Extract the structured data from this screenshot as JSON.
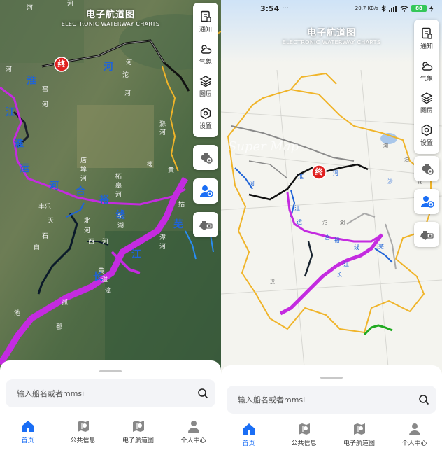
{
  "app": {
    "title_cn": "电子航道图",
    "title_en": "ELECTRONIC WATERWAY CHARTS"
  },
  "tools": [
    {
      "label": "通知",
      "icon": "notice-icon"
    },
    {
      "label": "气象",
      "icon": "weather-icon"
    },
    {
      "label": "图层",
      "icon": "layers-icon"
    },
    {
      "label": "设置",
      "icon": "settings-icon"
    }
  ],
  "search": {
    "placeholder": "输入船名或者mmsi"
  },
  "tabs": [
    {
      "label": "首页",
      "icon": "home-icon",
      "active": true
    },
    {
      "label": "公共信息",
      "icon": "public-info-icon",
      "active": false
    },
    {
      "label": "电子航道图",
      "icon": "chart-map-icon",
      "active": false
    },
    {
      "label": "个人中心",
      "icon": "person-icon",
      "active": false
    }
  ],
  "status": {
    "time": "3:54",
    "more": "···",
    "net_speed": "20.7 KB/s",
    "battery": "88"
  },
  "map": {
    "end_marker": "终",
    "watermark": "Super Map",
    "left_labels": [
      "河",
      "河",
      "沱",
      "河",
      "河",
      "淮",
      "河",
      "江",
      "淮",
      "运",
      "河",
      "合",
      "裕",
      "线",
      "长",
      "江",
      "芜",
      "丰乐",
      "天",
      "石",
      "白",
      "北",
      "河",
      "西",
      "河",
      "店埠河",
      "柘皋河",
      "杭",
      "湖",
      "江",
      "巢湖",
      "河",
      "黄",
      "瘦",
      "杭",
      "滁河",
      "池",
      "卯",
      "黄",
      "漳",
      "孤"
    ],
    "right_labels": [
      "沙",
      "河",
      "淮",
      "河",
      "江",
      "泊",
      "运",
      "河",
      "合",
      "裕",
      "线",
      "长",
      "江",
      "芜",
      "沱",
      "河",
      "湖",
      "城",
      "汉",
      "江"
    ]
  },
  "colors": {
    "accent": "#1a6ef5",
    "waterway_purple": "#c42be0",
    "boundary_yellow": "#f0b429",
    "end_red": "#e02020"
  }
}
